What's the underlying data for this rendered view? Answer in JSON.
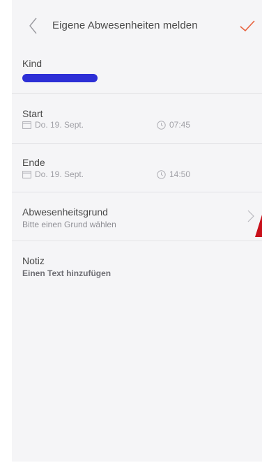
{
  "header": {
    "title": "Eigene Abwesenheiten melden",
    "back_icon": "chevron-left-icon",
    "confirm_icon": "checkmark-icon"
  },
  "kind": {
    "label": "Kind"
  },
  "start": {
    "label": "Start",
    "date": "Do. 19. Sept.",
    "time": "07:45"
  },
  "end": {
    "label": "Ende",
    "date": "Do. 19. Sept.",
    "time": "14:50"
  },
  "reason": {
    "label": "Abwesenheitsgrund",
    "placeholder": "Bitte einen Grund wählen"
  },
  "note": {
    "label": "Notiz",
    "placeholder": "Einen Text hinzufügen"
  },
  "colors": {
    "accent": "#e8623e",
    "background": "#f5f5f7",
    "redaction": "#2d2fd6",
    "marker": "#c8101a"
  }
}
